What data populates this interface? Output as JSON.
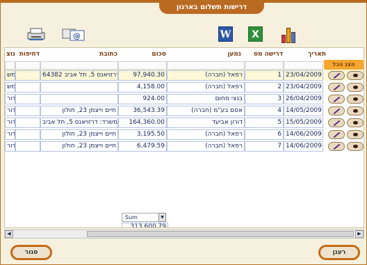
{
  "window": {
    "title": "דרישות תשלום בארגון"
  },
  "toolbar": {
    "word_icon": "word-icon",
    "excel_icon": "excel-icon",
    "chart_icon": "chart-icon",
    "printer_icon": "printer-icon",
    "email_icon": "email-icon"
  },
  "grid": {
    "show_all_label": "הצג הכל",
    "columns": {
      "date": "תאריך",
      "request_no": "דרישה מס",
      "recipient": "נמען",
      "amount": "סכום",
      "address": "כתובת",
      "urgency": "דחיפות",
      "extra": "נוצ"
    },
    "rows": [
      {
        "date": "23/04/2009",
        "request_no": "1",
        "recipient": "רפאל (חברה)",
        "amount": "97,940.30",
        "address": "דרזויאנס 5, תל אביב 64382",
        "extra": "מש"
      },
      {
        "date": "23/04/2009",
        "request_no": "2",
        "recipient": "רפאל (חברה)",
        "amount": "4,158.00",
        "address": "",
        "extra": "מש"
      },
      {
        "date": "26/04/2009",
        "request_no": "3",
        "recipient": "בנצי מחום",
        "amount": "924.00",
        "address": "",
        "extra": "דור"
      },
      {
        "date": "14/05/2009",
        "request_no": "4",
        "recipient": "אסם בע\"מ (חברה)",
        "amount": "36,543.39",
        "address": "חיים וייצמן 23, חולון",
        "extra": "דור"
      },
      {
        "date": "15/05/2009",
        "request_no": "5",
        "recipient": "דורון אביעד",
        "amount": "164,360.00",
        "address": "משרד: דרזויאנס 5, תל אביב",
        "extra": "דור"
      },
      {
        "date": "14/06/2009",
        "request_no": "6",
        "recipient": "רפאל (חברה)",
        "amount": "3,195.50",
        "address": "חיים וייצמן 23, חולון",
        "extra": "דור"
      },
      {
        "date": "14/06/2009",
        "request_no": "7",
        "recipient": "רפאל (חברה)",
        "amount": "6,479.59",
        "address": "חיים וייצמן 23, חולון",
        "extra": "דור"
      }
    ],
    "summary": {
      "function": "Sum",
      "total": "313,600.79"
    }
  },
  "footer": {
    "close_label": "סגור",
    "refresh_label": "רענן"
  }
}
